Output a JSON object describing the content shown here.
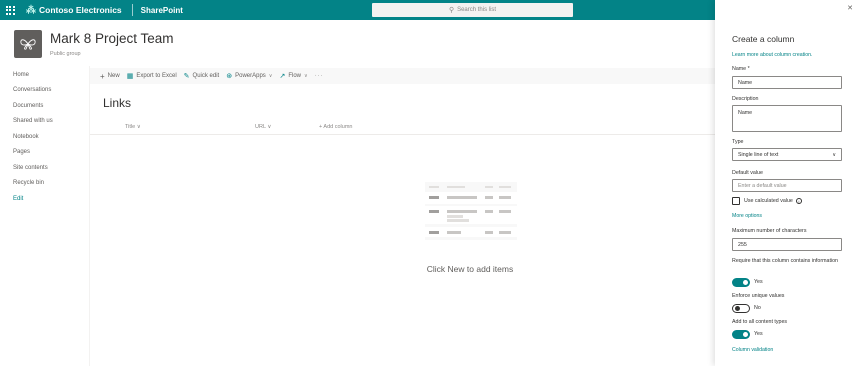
{
  "suite": {
    "brand": "Contoso Electronics",
    "app": "SharePoint",
    "search_placeholder": "Search this list"
  },
  "site": {
    "title": "Mark 8 Project Team",
    "subtitle": "Public group"
  },
  "nav": {
    "items": [
      "Home",
      "Conversations",
      "Documents",
      "Shared with us",
      "Notebook",
      "Pages",
      "Site contents",
      "Recycle bin",
      "Edit"
    ]
  },
  "commands": {
    "new": "New",
    "export": "Export to Excel",
    "quick_edit": "Quick edit",
    "powerapps": "PowerApps",
    "flow": "Flow",
    "more": "···"
  },
  "list": {
    "title": "Links",
    "columns": [
      "Title",
      "URL",
      "+ Add column"
    ],
    "empty_text": "Click New to add items"
  },
  "panel": {
    "title": "Create a column",
    "learn_more": "Learn more about column creation.",
    "name_label": "Name *",
    "name_value": "Name",
    "description_label": "Description",
    "description_value": "Name",
    "type_label": "Type",
    "type_value": "Single line of text",
    "default_label": "Default value",
    "default_placeholder": "Enter a default value",
    "calculated_label": "Use calculated value",
    "more_options": "More options",
    "max_chars_label": "Maximum number of characters",
    "max_chars_value": "255",
    "require_label": "Require that this column contains information",
    "require_state": "Yes",
    "unique_label": "Enforce unique values",
    "unique_state": "No",
    "add_all_label": "Add to all content types",
    "add_all_state": "Yes",
    "validation_link": "Column validation"
  },
  "colors": {
    "accent": "#038387",
    "suitebar": "#038387"
  }
}
